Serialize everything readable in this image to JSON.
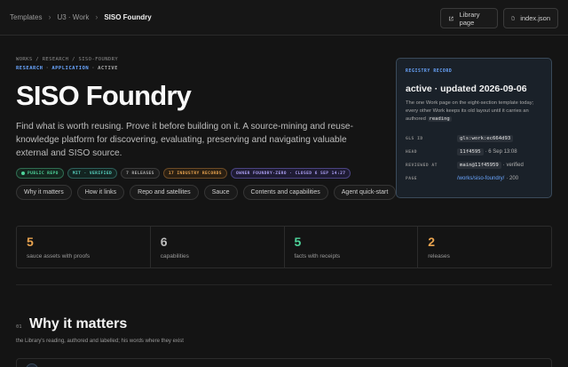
{
  "topbar": {
    "breadcrumbs": [
      "Templates",
      "U3 · Work",
      "SISO Foundry"
    ],
    "library_label": "Library page",
    "index_label": "index.json"
  },
  "hero": {
    "crumb": "WORKS / RESEARCH / SISO-FOUNDRY",
    "tag_1": "RESEARCH",
    "tag_2": "APPLICATION",
    "tag_3": "ACTIVE",
    "title": "SISO Foundry",
    "description": "Find what is worth reusing. Prove it before building on it. A source-mining and reuse-knowledge platform for discovering, evaluating, preserving and navigating valuable external and SISO source.",
    "badges": {
      "public": "PUBLIC REPO",
      "mit": "MIT · VERIFIED",
      "releases": "7 RELEASES",
      "industry": "17 INDUSTRY RECORDS",
      "owner": "OWNER FOUNDRY-ZERO · CLOSED 6 SEP 14:27"
    },
    "pills": [
      "Why it matters",
      "How it links",
      "Repo and satellites",
      "Sauce",
      "Contents and capabilities",
      "Agent quick-start"
    ]
  },
  "registry": {
    "label": "REGISTRY RECORD",
    "status": "active · updated 2026-09-06",
    "note_before": "The one Work page on the eight-section template today; every other Work keeps its old layout until it carries an authored",
    "note_code": "reading",
    "gls_key": "GLS ID",
    "gls_val": "gls:work:ec664d93",
    "head_key": "HEAD",
    "head_code": "11f4595",
    "head_rest": "· 6 Sep 13:08",
    "reviewed_key": "REVIEWED AT",
    "reviewed_code": "main@11f45959",
    "reviewed_rest": "· verified",
    "page_key": "PAGE",
    "page_link": "/works/siso-foundry/",
    "page_rest": "· 200"
  },
  "stats": [
    {
      "num": "5",
      "label": "sauce assets with proofs",
      "color": "#e8a34f"
    },
    {
      "num": "6",
      "label": "capabilities",
      "color": "#bdbdbd"
    },
    {
      "num": "5",
      "label": "facts with receipts",
      "color": "#4ed39a"
    },
    {
      "num": "2",
      "label": "releases",
      "color": "#e8a34f"
    }
  ],
  "section": {
    "num": "01",
    "title": "Why it matters",
    "subtitle": "the Library's reading, authored and labelled; his words where they exist"
  }
}
